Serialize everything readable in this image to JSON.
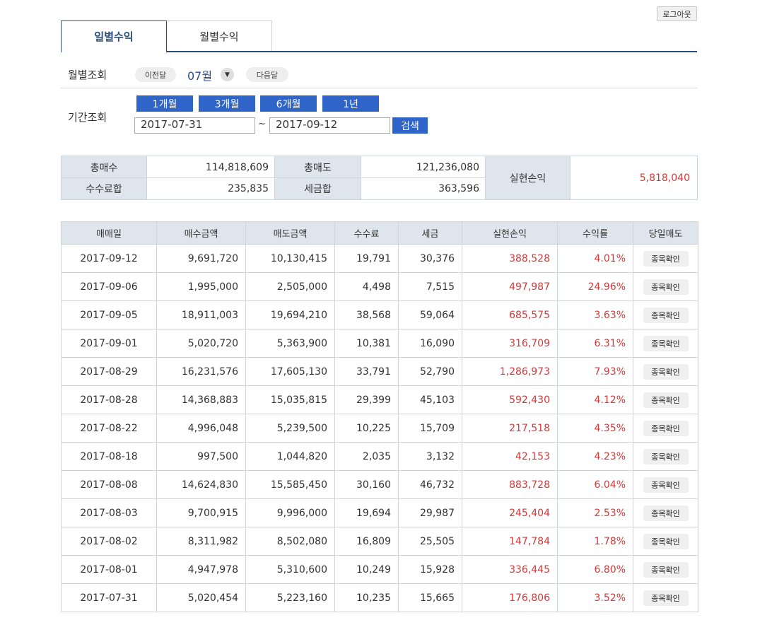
{
  "header": {
    "logout_label": "로그아웃"
  },
  "tabs": [
    {
      "label": "일별수익",
      "active": true
    },
    {
      "label": "월별수익",
      "active": false
    }
  ],
  "month_search": {
    "label": "월별조회",
    "prev_label": "이전달",
    "month_value": "07월",
    "next_label": "다음달"
  },
  "period_search": {
    "label": "기간조회",
    "buttons": [
      "1개월",
      "3개월",
      "6개월",
      "1년"
    ],
    "start_date": "2017-07-31",
    "separator": "~",
    "end_date": "2017-09-12",
    "search_label": "검색"
  },
  "summary": {
    "total_buy_label": "총매수",
    "total_buy": "114,818,609",
    "total_sell_label": "총매도",
    "total_sell": "121,236,080",
    "fee_total_label": "수수료합",
    "fee_total": "235,835",
    "tax_total_label": "세금합",
    "tax_total": "363,596",
    "realized_label": "실현손익",
    "realized": "5,818,040"
  },
  "colors": {
    "accent": "#2f64c9",
    "profit": "#d33a3a",
    "header_bg": "#dfe5ec",
    "tab_border": "#2a4e7a"
  },
  "table": {
    "columns": [
      "매매일",
      "매수금액",
      "매도금액",
      "수수료",
      "세금",
      "실현손익",
      "수익률",
      "당일매도"
    ],
    "confirm_label": "종목확인",
    "rows": [
      [
        "2017-09-12",
        "9,691,720",
        "10,130,415",
        "19,791",
        "30,376",
        "388,528",
        "4.01%"
      ],
      [
        "2017-09-06",
        "1,995,000",
        "2,505,000",
        "4,498",
        "7,515",
        "497,987",
        "24.96%"
      ],
      [
        "2017-09-05",
        "18,911,003",
        "19,694,210",
        "38,568",
        "59,064",
        "685,575",
        "3.63%"
      ],
      [
        "2017-09-01",
        "5,020,720",
        "5,363,900",
        "10,381",
        "16,090",
        "316,709",
        "6.31%"
      ],
      [
        "2017-08-29",
        "16,231,576",
        "17,605,130",
        "33,791",
        "52,790",
        "1,286,973",
        "7.93%"
      ],
      [
        "2017-08-28",
        "14,368,883",
        "15,035,815",
        "29,399",
        "45,103",
        "592,430",
        "4.12%"
      ],
      [
        "2017-08-22",
        "4,996,048",
        "5,239,500",
        "10,225",
        "15,709",
        "217,518",
        "4.35%"
      ],
      [
        "2017-08-18",
        "997,500",
        "1,044,820",
        "2,035",
        "3,132",
        "42,153",
        "4.23%"
      ],
      [
        "2017-08-08",
        "14,624,830",
        "15,585,450",
        "30,160",
        "46,732",
        "883,728",
        "6.04%"
      ],
      [
        "2017-08-03",
        "9,700,915",
        "9,996,000",
        "19,694",
        "29,987",
        "245,404",
        "2.53%"
      ],
      [
        "2017-08-02",
        "8,311,982",
        "8,502,080",
        "16,809",
        "25,505",
        "147,784",
        "1.78%"
      ],
      [
        "2017-08-01",
        "4,947,978",
        "5,310,600",
        "10,249",
        "15,928",
        "336,445",
        "6.80%"
      ],
      [
        "2017-07-31",
        "5,020,454",
        "5,223,160",
        "10,235",
        "15,665",
        "176,806",
        "3.52%"
      ]
    ]
  }
}
